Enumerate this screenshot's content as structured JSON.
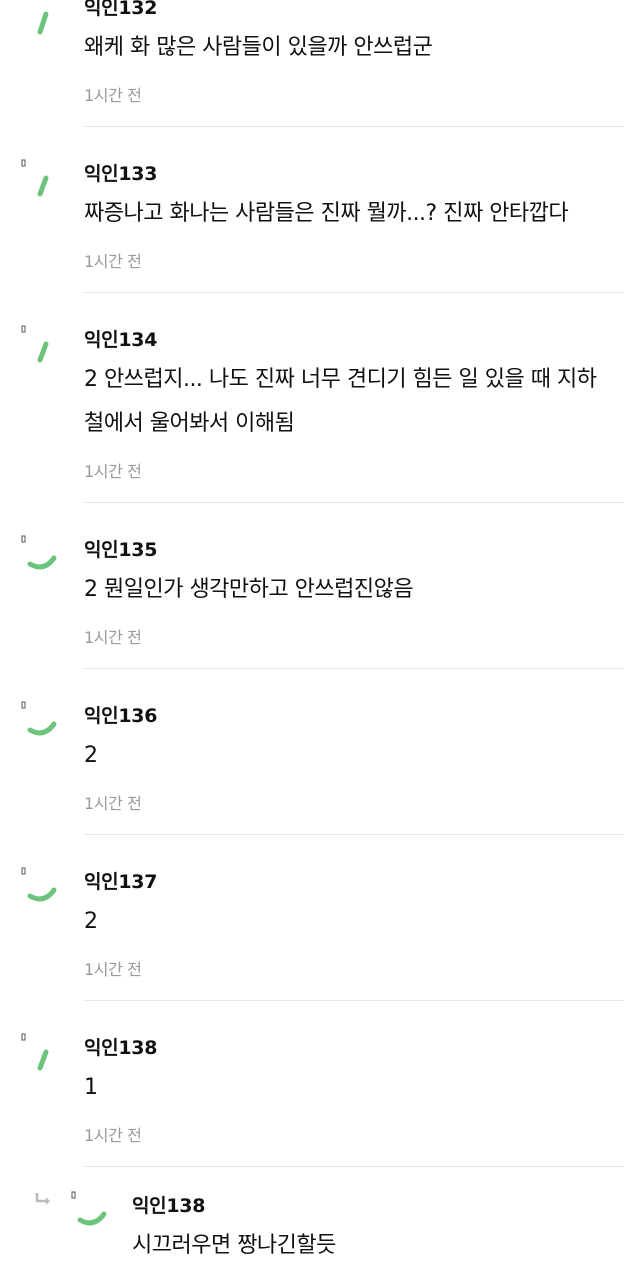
{
  "comments": [
    {
      "author": "익인132",
      "text": "왜케 화 많은 사람들이 있을까 안쓰럽군",
      "time": "1시간 전",
      "avatar_icon": "avatar-stroke-diagonal"
    },
    {
      "author": "익인133",
      "text": "짜증나고 화나는 사람들은 진짜 뭘까...? 진짜 안타깝다",
      "time": "1시간 전",
      "avatar_icon": "avatar-stroke-diagonal"
    },
    {
      "author": "익인134",
      "text": "2 안쓰럽지... 나도 진짜 너무 견디기 힘든 일 있을 때 지하철에서 울어봐서 이해됨",
      "time": "1시간 전",
      "avatar_icon": "avatar-stroke-diagonal"
    },
    {
      "author": "익인135",
      "text": "2 뭔일인가 생각만하고 안쓰럽진않음",
      "time": "1시간 전",
      "avatar_icon": "avatar-stroke-curve"
    },
    {
      "author": "익인136",
      "text": "2",
      "time": "1시간 전",
      "avatar_icon": "avatar-stroke-curve"
    },
    {
      "author": "익인137",
      "text": "2",
      "time": "1시간 전",
      "avatar_icon": "avatar-stroke-curve"
    },
    {
      "author": "익인138",
      "text": "1",
      "time": "1시간 전",
      "avatar_icon": "avatar-stroke-diagonal"
    }
  ],
  "reply": {
    "author": "익인138",
    "text": "시끄러우면 짱나긴할듯",
    "avatar_icon": "avatar-stroke-curve",
    "reply_icon": "reply-arrow-icon"
  },
  "colors": {
    "avatar_stroke": "#6cc47c",
    "time": "#9a9a9a",
    "divider": "#e6e6e6"
  }
}
